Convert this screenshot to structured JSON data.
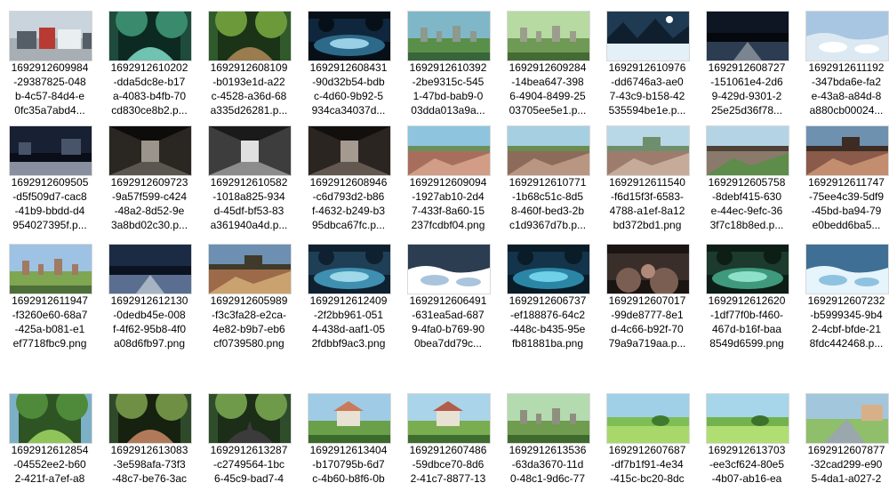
{
  "files": [
    {
      "name": "1692912609984\n-29387825-048\nb-4c57-84d4-e\n0fc35a7abd4...",
      "scene": "buildings",
      "palette": [
        "#c9d4dc",
        "#a7aeb4",
        "#b73a33",
        "#555d66"
      ]
    },
    {
      "name": "1692912610202\n-dda5dc8e-b17\na-4083-b4fb-70\ncd830ce8b2.p...",
      "scene": "forest-stream",
      "palette": [
        "#1e4b3c",
        "#3a8a6d",
        "#6fc3b0",
        "#0d2a22"
      ]
    },
    {
      "name": "1692912608109\n-b0193e1d-a22\nc-4528-a36d-68\na335d26281.p...",
      "scene": "forest-path",
      "palette": [
        "#305a2c",
        "#6c9a3a",
        "#9a7c4e",
        "#1b3317"
      ]
    },
    {
      "name": "1692912608431\n-90d32b54-bdb\nc-4d60-9b92-5\n934ca34037d...",
      "scene": "night-lake",
      "palette": [
        "#10263c",
        "#2d6a8a",
        "#9ad0e6",
        "#071018"
      ]
    },
    {
      "name": "1692912610392\n-2be9315c-545\n1-47bd-bab9-0\n03dda013a9a...",
      "scene": "ruins-grass",
      "palette": [
        "#7fb7c9",
        "#5a8f4a",
        "#8d9a8e",
        "#39653a"
      ]
    },
    {
      "name": "1692912609284\n-14bea647-398\n6-4904-8499-25\n03705ee5e1.p...",
      "scene": "graveyard",
      "palette": [
        "#b7d9a2",
        "#6f9a55",
        "#9c9e8c",
        "#446b33"
      ]
    },
    {
      "name": "1692912610976\n-dd6746a3-ae0\n7-43c9-b158-42\n535594be1e.p...",
      "scene": "snow-night",
      "palette": [
        "#1f3a53",
        "#6fa0c2",
        "#e3f0f7",
        "#0f1f2d"
      ]
    },
    {
      "name": "1692912608727\n-151061e4-2d6\n9-429d-9301-2\n25e25d36f78...",
      "scene": "night-road",
      "palette": [
        "#0e1623",
        "#2c3d52",
        "#7b8591",
        "#05080c"
      ]
    },
    {
      "name": "1692912611192\n-347bda6e-fa2\ne-43a8-a84d-8\na880cb00024...",
      "scene": "snowfield",
      "palette": [
        "#a8c6e2",
        "#ffffff",
        "#dce9f3",
        "#7e9bb6"
      ]
    },
    {
      "name": "1692912609505\n-d5f509d7-cac8\n-41b9-bbdd-d4\n954027395f.p...",
      "scene": "night-ruins",
      "palette": [
        "#182033",
        "#48546a",
        "#8a8fa0",
        "#0a0e18"
      ]
    },
    {
      "name": "1692912609723\n-9a57f599-c424\n-48a2-8d52-9e\n3a8bd02c30.p...",
      "scene": "corridor-dark",
      "palette": [
        "#2a2622",
        "#5c5650",
        "#9a948c",
        "#0e0c0a"
      ]
    },
    {
      "name": "1692912610582\n-1018a825-934\nd-45df-bf53-83\na361940a4d.p...",
      "scene": "corridor-light",
      "palette": [
        "#3d3d3d",
        "#8c8c8c",
        "#e0e0e0",
        "#1a1a1a"
      ]
    },
    {
      "name": "1692912608946\n-c6d793d2-b86\nf-4632-b249-b3\n95dbca67fc.p...",
      "scene": "corridor-dark",
      "palette": [
        "#2b2522",
        "#625850",
        "#a49a90",
        "#120f0d"
      ]
    },
    {
      "name": "1692912609094\n-1927ab10-2d4\n7-433f-8a60-15\n237fcdbf04.png",
      "scene": "rubble-field",
      "palette": [
        "#8fc4df",
        "#a86e5d",
        "#d19d86",
        "#6b8f5a"
      ]
    },
    {
      "name": "1692912610771\n-1b68c51c-8d5\n8-460f-bed3-2b\nc1d9367d7b.p...",
      "scene": "rubble-field",
      "palette": [
        "#a7cfe2",
        "#8d6b5a",
        "#b99682",
        "#688d4e"
      ]
    },
    {
      "name": "1692912611540\n-f6d15f3f-6583-\n4788-a1ef-8a12\nbd372bd1.png",
      "scene": "rubble-city",
      "palette": [
        "#b9d8e7",
        "#9d7c6d",
        "#c7ab9a",
        "#6f8e6c"
      ]
    },
    {
      "name": "1692912605758\n-8debf415-630\ne-44ec-9efc-36\n3f7c18b8ed.p...",
      "scene": "cracked-ground",
      "palette": [
        "#b4d4e6",
        "#8a7a6b",
        "#5d8c4b",
        "#4e4136"
      ]
    },
    {
      "name": "1692912611747\n-75ee4c39-5df9\n-45bd-ba94-79\ne0bedd6ba5...",
      "scene": "ruins-sunset",
      "palette": [
        "#6e91b0",
        "#8a5a4a",
        "#c38d6f",
        "#3d2c24"
      ]
    },
    {
      "name": "1692912611947\n-f3260e60-68a7\n-425a-b081-e1\nef7718fbc9.png",
      "scene": "ruins-grass",
      "palette": [
        "#9ec2e3",
        "#7fa650",
        "#a07a63",
        "#4e6f39"
      ]
    },
    {
      "name": "1692912612130\n-0dedb45e-008\nf-4f62-95b8-4f0\na08d6fb97.png",
      "scene": "night-road",
      "palette": [
        "#1c2b44",
        "#5a6f8f",
        "#a6b3c3",
        "#0b1220"
      ]
    },
    {
      "name": "1692912605989\n-f3c3fa28-e2ca-\n4e82-b9b7-eb6\ncf0739580.png",
      "scene": "ruins-sunset",
      "palette": [
        "#6d8fb1",
        "#9c6a48",
        "#c9a26f",
        "#3f3a2a"
      ]
    },
    {
      "name": "1692912612409\n-2f2bb961-051\n4-438d-aaf1-05\n2fdbbf9ac3.png",
      "scene": "cave-water",
      "palette": [
        "#1f3f56",
        "#3f8fb0",
        "#9fd8e8",
        "#0f2130"
      ]
    },
    {
      "name": "1692912606491\n-631ea5ad-687\n9-4fa0-b769-90\n0bea7dd79c...",
      "scene": "ice-cave",
      "palette": [
        "#2c3d52",
        "#a9c4dc",
        "#ffffff",
        "#141d28"
      ]
    },
    {
      "name": "1692912606737\n-ef188876-64c2\n-448c-b435-95e\nfb81881ba.png",
      "scene": "cave-water",
      "palette": [
        "#13344a",
        "#2b86a6",
        "#6fd0e8",
        "#091c28"
      ]
    },
    {
      "name": "1692912607017\n-99de8777-8e1\nd-4c66-b92f-70\n79a9a719aa.p...",
      "scene": "cave-rocks",
      "palette": [
        "#3a2e2a",
        "#7a5e52",
        "#b08a78",
        "#1a1412"
      ]
    },
    {
      "name": "1692912612620\n-1df77f0b-f460-\n467d-b16f-baa\n8549d6599.png",
      "scene": "cave-water",
      "palette": [
        "#1c3a2e",
        "#3f9a7d",
        "#8fe0c9",
        "#0c1e16"
      ]
    },
    {
      "name": "1692912607232\n-b5999345-9b4\n2-4cbf-bfde-21\n8fdc442468.p...",
      "scene": "ice-field",
      "palette": [
        "#3f6f94",
        "#8fc2e0",
        "#e6f4fb",
        "#1f3d55"
      ]
    },
    {
      "name": "1692912612854\n-04552ee2-b60\n2-421f-a7ef-a8",
      "scene": "forest-field",
      "palette": [
        "#7cb0c7",
        "#4f8a3a",
        "#8fc45a",
        "#2e5424"
      ]
    },
    {
      "name": "1692912613083\n-3e598afa-73f3\n-48c7-be76-3ac",
      "scene": "forest-tunnel",
      "palette": [
        "#2f4a2a",
        "#6f8f45",
        "#b07a5a",
        "#16220f"
      ]
    },
    {
      "name": "1692912613287\n-c2749564-1bc\n6-45c9-bad7-4",
      "scene": "forest-tunnel-road",
      "palette": [
        "#2f4d2b",
        "#6f9a4a",
        "#3b3b3b",
        "#1c2d18"
      ]
    },
    {
      "name": "1692912613404\n-b170795b-6d7\nc-4b60-b8f6-0b",
      "scene": "house-grass",
      "palette": [
        "#9fcbe6",
        "#6aa04a",
        "#c97a5a",
        "#3c6a2c"
      ]
    },
    {
      "name": "1692912607486\n-59dbce70-8d6\n2-41c7-8877-13",
      "scene": "house-grass",
      "palette": [
        "#a9d4ea",
        "#79ad4f",
        "#b35c4a",
        "#3f6d30"
      ]
    },
    {
      "name": "1692912613536\n-63da3670-11d\n0-48c1-9d6c-77",
      "scene": "graveyard",
      "palette": [
        "#b4dab0",
        "#6f9c4e",
        "#8e8f7e",
        "#3f6a2e"
      ]
    },
    {
      "name": "1692912607687\n-df7b1f91-4e34\n-415c-bc20-8dc",
      "scene": "grass-field",
      "palette": [
        "#9fd0e8",
        "#7fbd55",
        "#a8d86a",
        "#3f7a2e"
      ]
    },
    {
      "name": "1692912613703\n-ee3cf624-80e5\n-4b07-ab16-ea",
      "scene": "grass-field",
      "palette": [
        "#a7d5ea",
        "#73b34d",
        "#b0de72",
        "#3c7229"
      ]
    },
    {
      "name": "1692912607877\n-32cad299-e90\n5-4da1-a027-2",
      "scene": "town-road",
      "palette": [
        "#a2c6dc",
        "#8fbf6a",
        "#9aa7ad",
        "#4b6b3c"
      ]
    }
  ]
}
